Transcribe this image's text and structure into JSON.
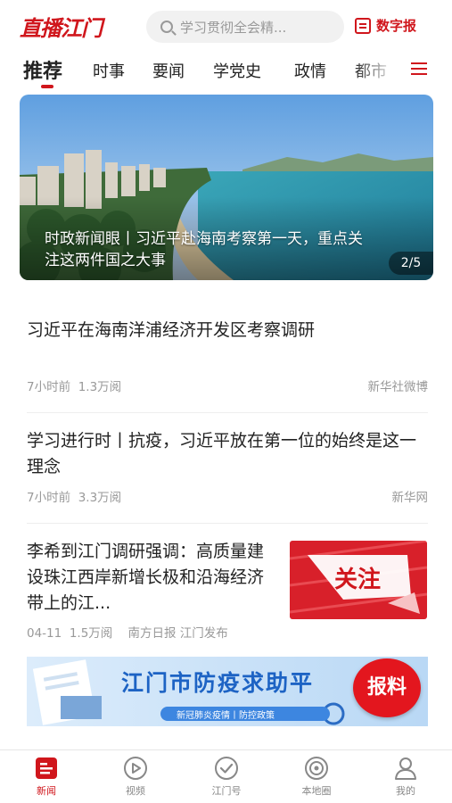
{
  "header": {
    "logo": "直播江门",
    "search_placeholder": "学习贯彻全会精...",
    "epaper_label": "数字报"
  },
  "tabs": [
    "推荐",
    "时事",
    "要闻",
    "学党史",
    "政情",
    "都市"
  ],
  "banner": {
    "title": "时政新闻眼丨习近平赴海南考察第一天，重点关注这两件国之大事",
    "counter": "2/5"
  },
  "news": [
    {
      "title": "习近平在海南洋浦经济开发区考察调研",
      "time": "7小时前",
      "views": "1.3万阅",
      "source": "新华社微博"
    },
    {
      "title": "学习进行时丨抗疫，习近平放在第一位的始终是这一理念",
      "time": "7小时前",
      "views": "3.3万阅",
      "source": "新华网"
    },
    {
      "title": "李希到江门调研强调：高质量建设珠江西岸新增长极和沿海经济带上的江...",
      "time": "04-11",
      "views": "1.5万阅",
      "source": "南方日报 江门发布",
      "thumb_text": "关注"
    }
  ],
  "ad": {
    "title": "江门市防疫求助平",
    "subtitle": "新冠肺炎疫情丨防控政策",
    "badge": "报料"
  },
  "tabbar": [
    {
      "label": "新闻",
      "icon": "news-icon",
      "active": true
    },
    {
      "label": "视频",
      "icon": "video-icon",
      "active": false
    },
    {
      "label": "江门号",
      "icon": "jiangmen-account-icon",
      "active": false
    },
    {
      "label": "本地圈",
      "icon": "local-circle-icon",
      "active": false
    },
    {
      "label": "我的",
      "icon": "profile-icon",
      "active": false
    }
  ],
  "colors": {
    "brand": "#d0161c",
    "muted": "#999999"
  }
}
